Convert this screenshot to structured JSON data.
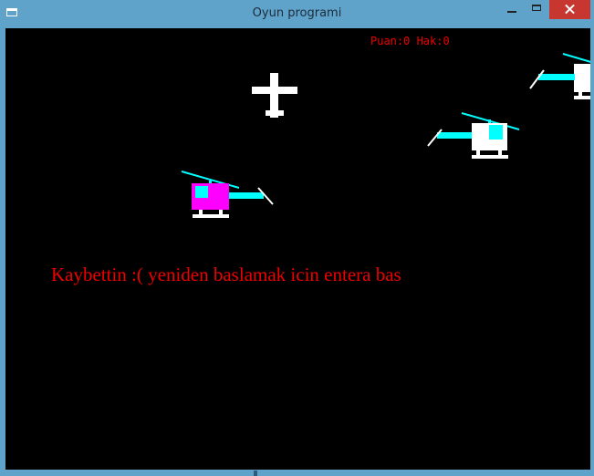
{
  "window": {
    "title": "Oyun programi",
    "icons": {
      "app": "window-icon",
      "minimize": "minimize-icon",
      "maximize": "maximize-icon",
      "close": "close-icon"
    }
  },
  "game": {
    "hud": {
      "score_text": "Puan:0 Hak:0"
    },
    "message": "Kaybettin :( yeniden baslamak icin entera bas",
    "colors": {
      "background": "#000000",
      "text": "#ee0000",
      "player": "#ff00ff",
      "rotor": "#00ffff",
      "enemy": "#ffffff",
      "plane": "#ffffff"
    }
  }
}
